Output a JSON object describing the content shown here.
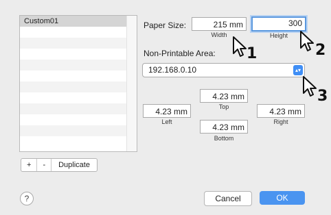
{
  "list": {
    "items": [
      "Custom01",
      "",
      "",
      "",
      "",
      "",
      "",
      "",
      "",
      "",
      "",
      ""
    ],
    "add_label": "+",
    "remove_label": "-",
    "duplicate_label": "Duplicate"
  },
  "paper_size": {
    "label": "Paper Size:",
    "width_value": "215 mm",
    "width_caption": "Width",
    "height_value": "300",
    "height_caption": "Height"
  },
  "non_printable": {
    "label": "Non-Printable Area:",
    "selected": "192.168.0.10",
    "top_value": "4.23 mm",
    "top_caption": "Top",
    "left_value": "4.23 mm",
    "left_caption": "Left",
    "right_value": "4.23 mm",
    "right_caption": "Right",
    "bottom_value": "4.23 mm",
    "bottom_caption": "Bottom"
  },
  "footer": {
    "help_label": "?",
    "cancel_label": "Cancel",
    "ok_label": "OK"
  },
  "callouts": [
    "1",
    "2",
    "3"
  ],
  "colors": {
    "accent": "#4a94f0",
    "focus_ring": "#5a98df"
  }
}
